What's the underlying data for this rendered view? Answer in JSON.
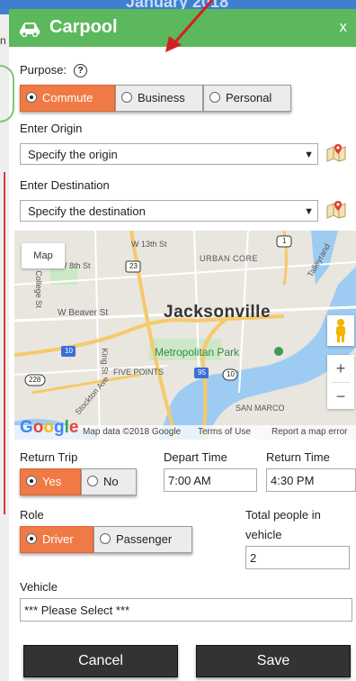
{
  "background": {
    "title": "January 2018",
    "left_text": "n"
  },
  "header": {
    "title": "Carpool",
    "close": "x",
    "icon": "car-icon"
  },
  "purpose": {
    "label": "Purpose:",
    "help": "?",
    "options": [
      "Commute",
      "Business",
      "Personal"
    ],
    "selected": "Commute"
  },
  "origin": {
    "label": "Enter Origin",
    "value": "Specify the origin"
  },
  "destination": {
    "label": "Enter Destination",
    "value": "Specify the destination"
  },
  "map": {
    "type_button": "Map",
    "city": "Jacksonville",
    "park": "Metropolitan Park",
    "labels": {
      "w13th": "W 13th St",
      "urban_core": "URBAN CORE",
      "w_beaver": "W Beaver St",
      "five_points": "FIVE POINTS",
      "san_marco": "SAN MARCO",
      "talleyrand": "Talleyrand",
      "w_ave": "W 8th St",
      "king": "King St",
      "brooklyn": "Stockton Ave",
      "roosevelt": "College St"
    },
    "shields": {
      "s1": "1",
      "s23": "23",
      "s10": "10",
      "s95": "95",
      "s228": "228",
      "s10b": "10"
    },
    "footer": {
      "data": "Map data ©2018 Google",
      "terms": "Terms of Use",
      "report": "Report a map error"
    },
    "google": "Google",
    "zoom_in": "+",
    "zoom_out": "−"
  },
  "return_trip": {
    "label": "Return Trip",
    "options": [
      "Yes",
      "No"
    ],
    "selected": "Yes"
  },
  "depart": {
    "label": "Depart Time",
    "value": "7:00 AM"
  },
  "return_time": {
    "label": "Return Time",
    "value": "4:30 PM"
  },
  "role": {
    "label": "Role",
    "options": [
      "Driver",
      "Passenger"
    ],
    "selected": "Driver"
  },
  "total": {
    "label_line1": "Total people in",
    "label_line2": "vehicle",
    "value": "2"
  },
  "vehicle": {
    "label": "Vehicle",
    "value": "*** Please Select ***"
  },
  "buttons": {
    "cancel": "Cancel",
    "save": "Save"
  },
  "colors": {
    "header": "#5cb85c",
    "selected": "#f07a45",
    "button": "#333333"
  }
}
